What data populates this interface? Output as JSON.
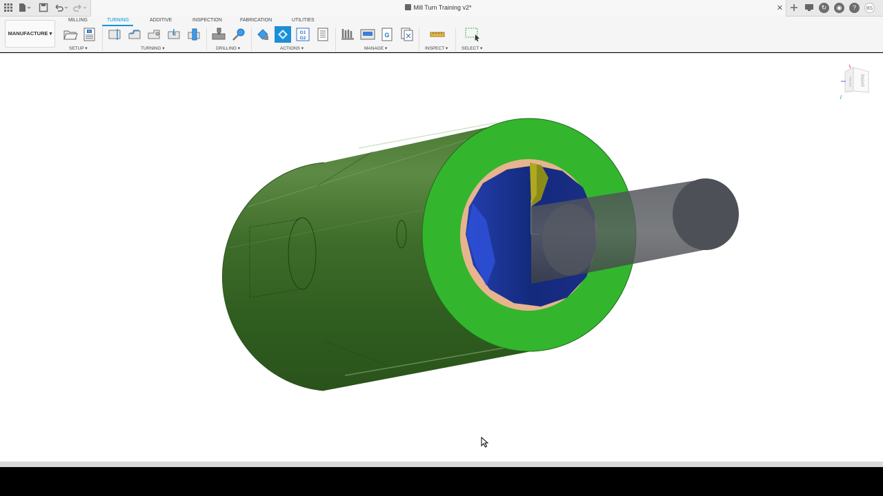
{
  "titlebar": {
    "document_title": "Mill Turn Training v2*",
    "close_tab": "✕",
    "user_initials": "BS"
  },
  "workspace": {
    "label": "MANUFACTURE ▾"
  },
  "tabs": [
    {
      "label": "MILLING",
      "active": false
    },
    {
      "label": "TURNING",
      "active": true
    },
    {
      "label": "ADDITIVE",
      "active": false
    },
    {
      "label": "INSPECTION",
      "active": false
    },
    {
      "label": "FABRICATION",
      "active": false
    },
    {
      "label": "UTILITIES",
      "active": false
    }
  ],
  "groups": [
    {
      "label": "SETUP ▾"
    },
    {
      "label": "TURNING ▾"
    },
    {
      "label": "DRILLING ▾"
    },
    {
      "label": "ACTIONS ▾"
    },
    {
      "label": "MANAGE ▾"
    },
    {
      "label": "INSPECT ▾"
    },
    {
      "label": "SELECT ▾"
    }
  ],
  "tools": {
    "setup": [
      "open-folder-icon",
      "new-setup-icon"
    ],
    "turning": [
      "face-icon",
      "profile-roughing-icon",
      "profile-finishing-icon",
      "grooving-icon",
      "part-icon"
    ],
    "drilling": [
      "drill-icon",
      "thread-icon"
    ],
    "actions": [
      "simulate-icon",
      "generate-icon",
      "post-process-icon",
      "setup-sheet-icon"
    ],
    "manage": [
      "tool-library-icon",
      "template-library-icon",
      "post-library-icon",
      "nc-program-icon"
    ],
    "inspect": [
      "measure-icon"
    ],
    "select": [
      "window-select-icon"
    ]
  },
  "viewcube": {
    "face_label": "RIGHT",
    "side_label": "FRONT"
  },
  "colors": {
    "accent": "#0696d7",
    "stock_green": "#3a6b25",
    "face_green": "#34b434",
    "bore_blue": "#1a2f8e",
    "tool_gray": "#5e6167"
  }
}
